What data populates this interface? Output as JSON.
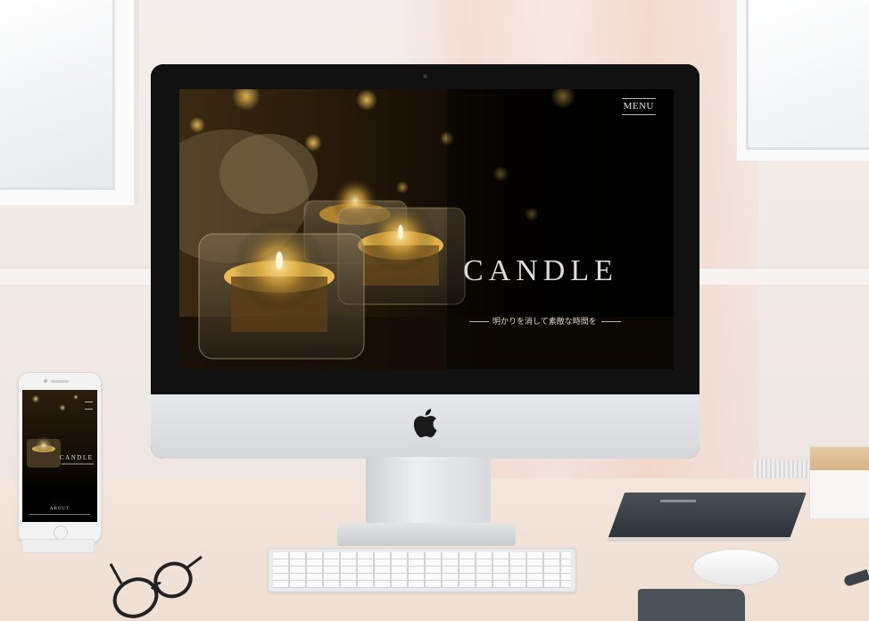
{
  "scene": {
    "description_kind": "desktop mockup",
    "device_brand_icon": "apple-logo-icon"
  },
  "website": {
    "menu_label": "MENU",
    "title": "CANDLE",
    "tagline": "明かりを消して素敵な時間を",
    "colors": {
      "background": "#000000",
      "title": "#dedad6",
      "accent_gold": "#d9a53b"
    }
  },
  "phone_site": {
    "title": "CANDLE",
    "section_label": "ABOUT"
  }
}
